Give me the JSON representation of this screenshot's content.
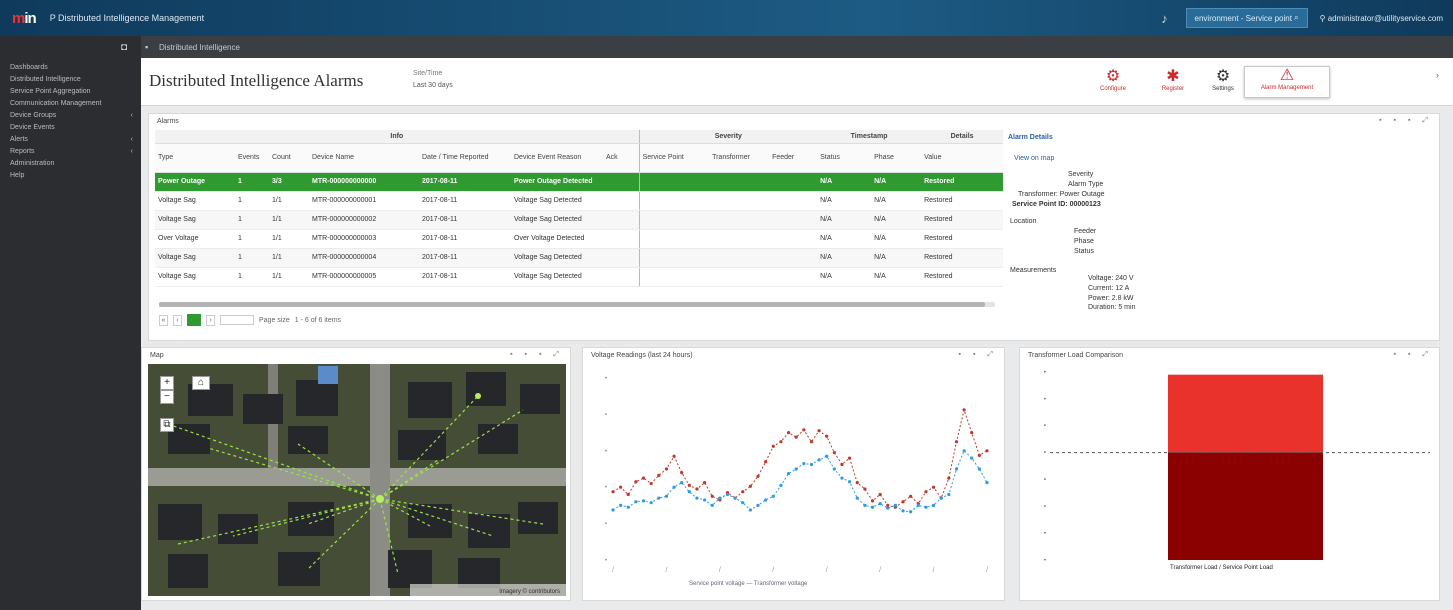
{
  "topbar": {
    "logo_m": "m",
    "logo_rest": "in",
    "app_title": "P  Distributed Intelligence Management",
    "btn_environment": "environment - Service point",
    "btn_search": "search",
    "user": "administrator@utilityservice.com"
  },
  "sidebar": {
    "items": [
      {
        "label": "Dashboards"
      },
      {
        "label": "Distributed Intelligence"
      },
      {
        "label": "Service Point Aggregation"
      },
      {
        "label": "Communication Management"
      },
      {
        "label": "Device Groups",
        "arrow": "‹"
      },
      {
        "label": "Device Events"
      },
      {
        "label": "Alerts",
        "arrow": "‹"
      },
      {
        "label": "Reports",
        "arrow": "‹"
      },
      {
        "label": "Administration"
      },
      {
        "label": "Help"
      }
    ]
  },
  "subbar": {
    "breadcrumb": "Distributed Intelligence"
  },
  "header": {
    "title": "Distributed Intelligence Alarms",
    "meta_label": "Site/Time",
    "meta_value": "Last 30 days",
    "actions": [
      {
        "glyph": "⚙",
        "label": "Configure"
      },
      {
        "glyph": "✱",
        "label": "Register"
      },
      {
        "glyph": "⚙",
        "label": "Settings"
      },
      {
        "glyph": "⚠",
        "label": "Alarm Management"
      }
    ]
  },
  "alarms_panel": {
    "title": "Alarms",
    "group_headers": [
      "Info",
      "Severity",
      "Timestamp",
      "Details"
    ],
    "columns": [
      "Type",
      "Events",
      "Count",
      "Device Name",
      "Date / Time Reported",
      "Device Event Reason",
      "Ack",
      "Service Point",
      "Transformer",
      "Feeder",
      "Status",
      "Phase",
      "Value"
    ],
    "rows": [
      {
        "type": "Power Outage",
        "events": "1",
        "count": "3/3",
        "device": "MTR-000000000000",
        "date": "2017-08-11",
        "reason": "Power Outage Detected",
        "ack": "",
        "sp": "",
        "tr": "",
        "feeder": "",
        "status": "N/A",
        "phase": "N/A",
        "value": "Restored"
      },
      {
        "type": "Voltage Sag",
        "events": "1",
        "count": "1/1",
        "device": "MTR-000000000001",
        "date": "2017-08-11",
        "reason": "Voltage Sag Detected",
        "ack": "",
        "sp": "",
        "tr": "",
        "feeder": "",
        "status": "N/A",
        "phase": "N/A",
        "value": "Restored"
      },
      {
        "type": "Voltage Sag",
        "events": "1",
        "count": "1/1",
        "device": "MTR-000000000002",
        "date": "2017-08-11",
        "reason": "Voltage Sag Detected",
        "ack": "",
        "sp": "",
        "tr": "",
        "feeder": "",
        "status": "N/A",
        "phase": "N/A",
        "value": "Restored"
      },
      {
        "type": "Over Voltage",
        "events": "1",
        "count": "1/1",
        "device": "MTR-000000000003",
        "date": "2017-08-11",
        "reason": "Over Voltage Detected",
        "ack": "",
        "sp": "",
        "tr": "",
        "feeder": "",
        "status": "N/A",
        "phase": "N/A",
        "value": "Restored"
      },
      {
        "type": "Voltage Sag",
        "events": "1",
        "count": "1/1",
        "device": "MTR-000000000004",
        "date": "2017-08-11",
        "reason": "Voltage Sag Detected",
        "ack": "",
        "sp": "",
        "tr": "",
        "feeder": "",
        "status": "N/A",
        "phase": "N/A",
        "value": "Restored"
      },
      {
        "type": "Voltage Sag",
        "events": "1",
        "count": "1/1",
        "device": "MTR-000000000005",
        "date": "2017-08-11",
        "reason": "Voltage Sag Detected",
        "ack": "",
        "sp": "",
        "tr": "",
        "feeder": "",
        "status": "N/A",
        "phase": "N/A",
        "value": "Restored"
      }
    ],
    "pager_text": "1 - 6 of 6 items",
    "pager_info": "Page size"
  },
  "details": {
    "header": "Alarm Details",
    "link": "View on map",
    "lines": [
      "Severity",
      "Alarm Type",
      "Transformer: Power Outage",
      "Service Point ID: 00000123"
    ],
    "section1": "Location",
    "sec1_lines": [
      "Feeder",
      "Phase",
      "Status"
    ],
    "section2": "Measurements",
    "sec2_lines": [
      "Voltage: 240 V",
      "Current: 12 A",
      "Power: 2.8 kW",
      "Duration: 5 min"
    ]
  },
  "map_panel": {
    "title": "Map",
    "zoom_in": "+",
    "zoom_out": "−",
    "layer": "⧉",
    "attribution": "Imagery © contributors"
  },
  "line_panel": {
    "title": "Voltage Readings (last 24 hours)",
    "legend": "Service point voltage  —  Transformer voltage"
  },
  "bar_panel": {
    "title": "Transformer Load Comparison",
    "xlabel": "Transformer Load / Service Point Load"
  },
  "colors": {
    "accent_green": "#2f9a2f",
    "alarm_red": "#cc2a2a",
    "series_red": "#c0392b",
    "series_blue": "#2e9be0",
    "bar_top": "#e8322b",
    "bar_bottom": "#8b0000"
  },
  "chart_data": [
    {
      "type": "line",
      "title": "Voltage Readings (last 24 hours)",
      "x": [
        0,
        1,
        2,
        3,
        4,
        5,
        6,
        7,
        8,
        9,
        10,
        11,
        12,
        13,
        14,
        15,
        16,
        17,
        18,
        19,
        20,
        21,
        22,
        23,
        24,
        25,
        26,
        27,
        28,
        29,
        30,
        31,
        32,
        33,
        34,
        35,
        36,
        37,
        38,
        39,
        40,
        41,
        42,
        43,
        44,
        45,
        46,
        47,
        48,
        49
      ],
      "series": [
        {
          "name": "Transformer voltage",
          "values": [
            243.5,
            244.0,
            243.2,
            244.6,
            245.0,
            244.4,
            245.3,
            246.0,
            247.4,
            245.6,
            244.2,
            243.8,
            244.5,
            243.0,
            242.6,
            243.4,
            242.8,
            243.5,
            244.1,
            245.2,
            246.8,
            248.5,
            249.0,
            250.0,
            249.5,
            250.3,
            249.0,
            250.2,
            249.6,
            247.8,
            246.5,
            247.2,
            244.5,
            243.8,
            242.5,
            243.2,
            242.0,
            241.8,
            242.4,
            243.0,
            242.2,
            243.5,
            244.0,
            242.8,
            245.0,
            249.0,
            252.5,
            250.0,
            247.5,
            248.0
          ]
        },
        {
          "name": "Service point voltage",
          "values": [
            241.5,
            242.0,
            241.8,
            242.4,
            242.5,
            242.3,
            242.8,
            243.0,
            244.0,
            244.5,
            243.5,
            242.8,
            242.6,
            242.0,
            242.8,
            243.2,
            242.8,
            242.3,
            241.5,
            242.0,
            242.6,
            243.0,
            244.2,
            245.5,
            246.0,
            246.6,
            246.5,
            247.0,
            247.4,
            246.0,
            245.0,
            244.6,
            242.8,
            242.0,
            241.8,
            242.2,
            241.7,
            242.0,
            241.4,
            241.3,
            242.0,
            241.8,
            242.0,
            242.8,
            243.2,
            246.0,
            248.0,
            247.2,
            246.0,
            244.5
          ]
        }
      ],
      "ylim": [
        236,
        256
      ]
    },
    {
      "type": "bar",
      "title": "Transformer Load Comparison",
      "categories": [
        "Transformer Load / Service Point Load"
      ],
      "series": [
        {
          "name": "Service point load",
          "values": [
            4
          ]
        },
        {
          "name": "Transformer load",
          "values": [
            2.9
          ]
        }
      ],
      "reference_line": 4,
      "ylim": [
        0,
        7
      ]
    }
  ]
}
